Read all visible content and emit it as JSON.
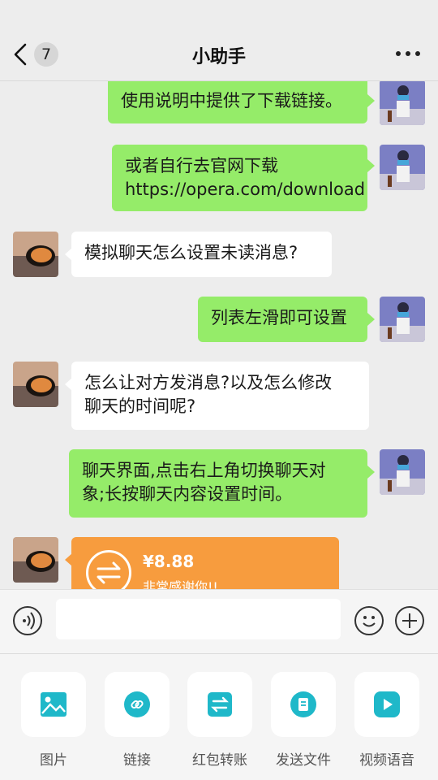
{
  "header": {
    "unread_count": "7",
    "title": "小助手"
  },
  "messages": [
    {
      "side": "me",
      "text": "使用说明中提供了下载链接。"
    },
    {
      "side": "me",
      "text": "或者自行去官网下载\nhttps://opera.com/download"
    },
    {
      "side": "them",
      "text": "模拟聊天怎么设置未读消息?"
    },
    {
      "side": "me",
      "text": "列表左滑即可设置"
    },
    {
      "side": "them",
      "text": "怎么让对方发消息?以及怎么修改\n聊天的时间呢?"
    },
    {
      "side": "me",
      "text": "聊天界面,点击右上角切换聊天对\n象;长按聊天内容设置时间。"
    }
  ],
  "transfer": {
    "amount": "¥8.88",
    "note": "非常感谢你!!"
  },
  "input": {
    "placeholder": ""
  },
  "tools": [
    {
      "label": "图片",
      "icon": "image-icon"
    },
    {
      "label": "链接",
      "icon": "link-icon"
    },
    {
      "label": "红包转账",
      "icon": "transfer-icon"
    },
    {
      "label": "发送文件",
      "icon": "file-icon"
    },
    {
      "label": "视频语音",
      "icon": "video-icon"
    }
  ],
  "colors": {
    "bubble_me": "#95ec69",
    "bubble_them": "#ffffff",
    "transfer": "#f79c3e",
    "tool_icon": "#1fb8c9"
  }
}
